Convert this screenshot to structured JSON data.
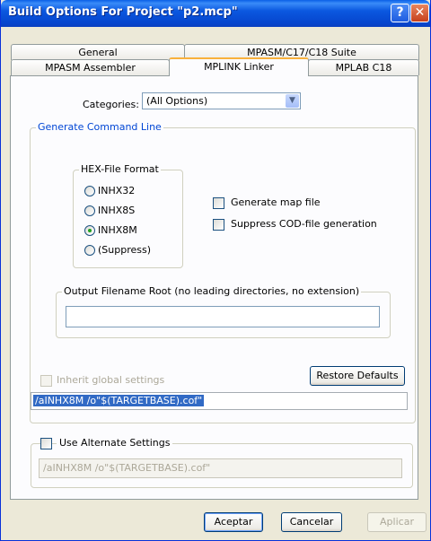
{
  "window": {
    "title": "Build Options For Project \"p2.mcp\"",
    "help_glyph": "?",
    "close_glyph": "✕"
  },
  "tabs": {
    "row1": [
      "General",
      "MPASM/C17/C18 Suite"
    ],
    "row2": [
      "MPASM Assembler",
      "MPLINK Linker",
      "MPLAB C18"
    ],
    "active": "MPLINK Linker"
  },
  "categories": {
    "label": "Categories:",
    "value": "(All Options)"
  },
  "generate": {
    "title": "Generate Command Line",
    "hex_format": {
      "title": "HEX-File Format",
      "options": [
        "INHX32",
        "INHX8S",
        "INHX8M",
        "(Suppress)"
      ],
      "selected": "INHX8M"
    },
    "generate_map_label": "Generate map file",
    "suppress_cod_label": "Suppress COD-file generation",
    "output_root": {
      "title": "Output Filename Root (no leading directories, no extension)",
      "value": ""
    },
    "inherit_label": "Inherit global settings",
    "restore_label": "Restore Defaults",
    "command_line": "/aINHX8M /o\"$(TARGETBASE).cof\""
  },
  "alternate": {
    "label": "Use Alternate Settings",
    "value": "/aINHX8M /o\"$(TARGETBASE).cof\""
  },
  "buttons": {
    "ok": "Aceptar",
    "cancel": "Cancelar",
    "apply": "Aplicar"
  }
}
